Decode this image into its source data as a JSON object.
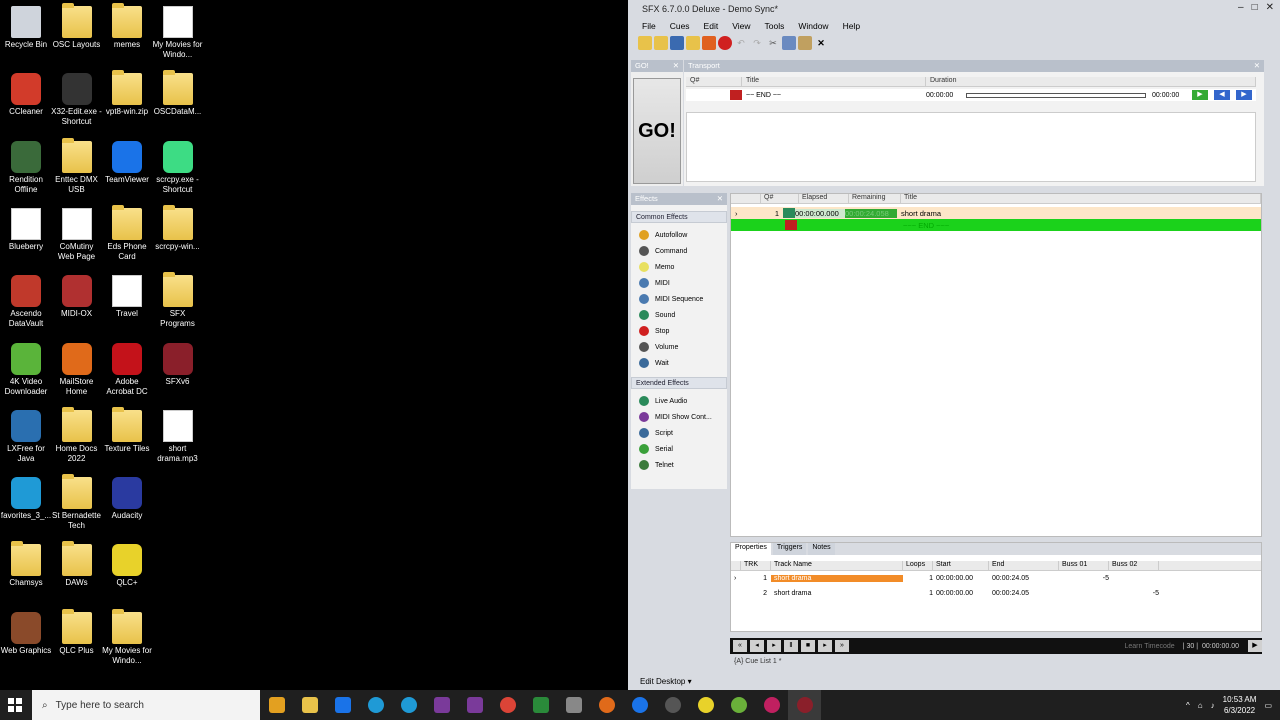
{
  "desktop": {
    "icons": [
      {
        "label": "Recycle Bin",
        "col": 0,
        "row": 0,
        "kind": "bin"
      },
      {
        "label": "OSC Layouts",
        "col": 1,
        "row": 0,
        "kind": "folder"
      },
      {
        "label": "memes",
        "col": 2,
        "row": 0,
        "kind": "folder"
      },
      {
        "label": "My Movies for Windo...",
        "col": 3,
        "row": 0,
        "kind": "paper"
      },
      {
        "label": "CCleaner",
        "col": 0,
        "row": 1,
        "kind": "app",
        "color": "#d23b2a"
      },
      {
        "label": "X32-Edit.exe - Shortcut",
        "col": 1,
        "row": 1,
        "kind": "app",
        "color": "#333333"
      },
      {
        "label": "vpt8-win.zip",
        "col": 2,
        "row": 1,
        "kind": "folder"
      },
      {
        "label": "OSCDataM...",
        "col": 3,
        "row": 1,
        "kind": "folder"
      },
      {
        "label": "Rendition Offline",
        "col": 0,
        "row": 2,
        "kind": "app",
        "color": "#3a6a3a"
      },
      {
        "label": "Enttec DMX USB",
        "col": 1,
        "row": 2,
        "kind": "folder"
      },
      {
        "label": "TeamViewer",
        "col": 2,
        "row": 2,
        "kind": "app",
        "color": "#1a73e8"
      },
      {
        "label": "scrcpy.exe - Shortcut",
        "col": 3,
        "row": 2,
        "kind": "app",
        "color": "#3ddc84"
      },
      {
        "label": "Blueberry",
        "col": 0,
        "row": 3,
        "kind": "paper"
      },
      {
        "label": "CoMutiny Web Page",
        "col": 1,
        "row": 3,
        "kind": "paper"
      },
      {
        "label": "Eds Phone Card",
        "col": 2,
        "row": 3,
        "kind": "folder"
      },
      {
        "label": "scrcpy-win...",
        "col": 3,
        "row": 3,
        "kind": "folder"
      },
      {
        "label": "Ascendo DataVault",
        "col": 0,
        "row": 4,
        "kind": "app",
        "color": "#c0392b"
      },
      {
        "label": "MIDI-OX",
        "col": 1,
        "row": 4,
        "kind": "app",
        "color": "#b03030"
      },
      {
        "label": "Travel",
        "col": 2,
        "row": 4,
        "kind": "paper"
      },
      {
        "label": "SFX Programs",
        "col": 3,
        "row": 4,
        "kind": "folder"
      },
      {
        "label": "4K Video Downloader",
        "col": 0,
        "row": 5,
        "kind": "app",
        "color": "#5ab43a"
      },
      {
        "label": "MailStore Home",
        "col": 1,
        "row": 5,
        "kind": "app",
        "color": "#e06a1a"
      },
      {
        "label": "Adobe Acrobat DC",
        "col": 2,
        "row": 5,
        "kind": "app",
        "color": "#c4121a"
      },
      {
        "label": "SFXv6",
        "col": 3,
        "row": 5,
        "kind": "app",
        "color": "#8a1f2a"
      },
      {
        "label": "LXFree for Java",
        "col": 0,
        "row": 6,
        "kind": "app",
        "color": "#2a6fb0"
      },
      {
        "label": "Home Docs 2022",
        "col": 1,
        "row": 6,
        "kind": "folder"
      },
      {
        "label": "Texture Tiles",
        "col": 2,
        "row": 6,
        "kind": "folder"
      },
      {
        "label": "short drama.mp3",
        "col": 3,
        "row": 6,
        "kind": "paper"
      },
      {
        "label": "favorites_3_...",
        "col": 0,
        "row": 7,
        "kind": "app",
        "color": "#1f9ad6"
      },
      {
        "label": "St Bernadette Tech",
        "col": 1,
        "row": 7,
        "kind": "folder"
      },
      {
        "label": "Audacity",
        "col": 2,
        "row": 7,
        "kind": "app",
        "color": "#2a3aa0"
      },
      {
        "label": "Chamsys",
        "col": 0,
        "row": 8,
        "kind": "folder"
      },
      {
        "label": "DAWs",
        "col": 1,
        "row": 8,
        "kind": "folder"
      },
      {
        "label": "QLC+",
        "col": 2,
        "row": 8,
        "kind": "app",
        "color": "#e8d22a"
      },
      {
        "label": "Web Graphics",
        "col": 0,
        "row": 9,
        "kind": "app",
        "color": "#8a4a2a"
      },
      {
        "label": "QLC Plus",
        "col": 1,
        "row": 9,
        "kind": "folder"
      },
      {
        "label": "My Movies for Windo...",
        "col": 2,
        "row": 9,
        "kind": "folder"
      }
    ]
  },
  "app": {
    "title": "SFX 6.7.0.0 Deluxe - Demo Sync*",
    "window_controls": [
      "–",
      "□",
      "✕"
    ],
    "menu": [
      "File",
      "Cues",
      "Edit",
      "View",
      "Tools",
      "Window",
      "Help"
    ],
    "go_panel": {
      "header": "GO!",
      "button": "GO!"
    },
    "transport": {
      "header": "Transport",
      "columns": [
        "Q#",
        "Title",
        "Duration"
      ],
      "row": {
        "title": "~~ END ~~",
        "duration": "00:00:00",
        "remaining": "00:00:00"
      }
    },
    "effects": {
      "header": "Effects",
      "common_label": "Common Effects",
      "common": [
        {
          "label": "Autofollow",
          "color": "#e0a020"
        },
        {
          "label": "Command",
          "color": "#555555"
        },
        {
          "label": "Memo",
          "color": "#e8e060"
        },
        {
          "label": "MIDI",
          "color": "#4a7ab0"
        },
        {
          "label": "MIDI Sequence",
          "color": "#4a7ab0"
        },
        {
          "label": "Sound",
          "color": "#2a8a5a"
        },
        {
          "label": "Stop",
          "color": "#d02020"
        },
        {
          "label": "Volume",
          "color": "#555555"
        },
        {
          "label": "Wait",
          "color": "#3a6a9a"
        }
      ],
      "extended_label": "Extended Effects",
      "extended": [
        {
          "label": "Live Audio",
          "color": "#2a8a5a"
        },
        {
          "label": "MIDI Show Cont...",
          "color": "#7a3a9a"
        },
        {
          "label": "Script",
          "color": "#3a6a9a"
        },
        {
          "label": "Serial",
          "color": "#3aa03a"
        },
        {
          "label": "Telnet",
          "color": "#3a7a3a"
        }
      ]
    },
    "cue_list": {
      "columns": [
        "Q#",
        "Elapsed",
        "Remaining",
        "Title"
      ],
      "rows": [
        {
          "q": "1",
          "elapsed": "00:00:00.000",
          "remaining": "00:00:24.058",
          "title": "short drama"
        },
        {
          "q": "",
          "elapsed": "",
          "remaining": "",
          "title": "~~~ END ~~~"
        }
      ]
    },
    "properties": {
      "tabs": [
        "Properties",
        "Triggers",
        "Notes"
      ],
      "columns": [
        "TRK",
        "Track Name",
        "Loops",
        "Start",
        "End",
        "Buss 01",
        "Buss 02"
      ],
      "tracks": [
        {
          "trk": "1",
          "name": "short drama",
          "loops": "1",
          "start": "00:00:00.00",
          "end": "00:00:24.05",
          "buss1": "-5",
          "buss2": ""
        },
        {
          "trk": "2",
          "name": "short drama",
          "loops": "1",
          "start": "00:00:00.00",
          "end": "00:00:24.05",
          "buss1": "",
          "buss2": "-5"
        }
      ]
    },
    "transport_bar": {
      "timecode_label": "Learn Timecode",
      "fps": "| 30 |",
      "time": "00:00:00.00"
    },
    "cue_list_tab": "{A} Cue List 1 *",
    "status": "Edit Desktop"
  },
  "taskbar": {
    "search_placeholder": "Type here to search",
    "time": "10:53 AM",
    "date": "6/3/2022"
  }
}
